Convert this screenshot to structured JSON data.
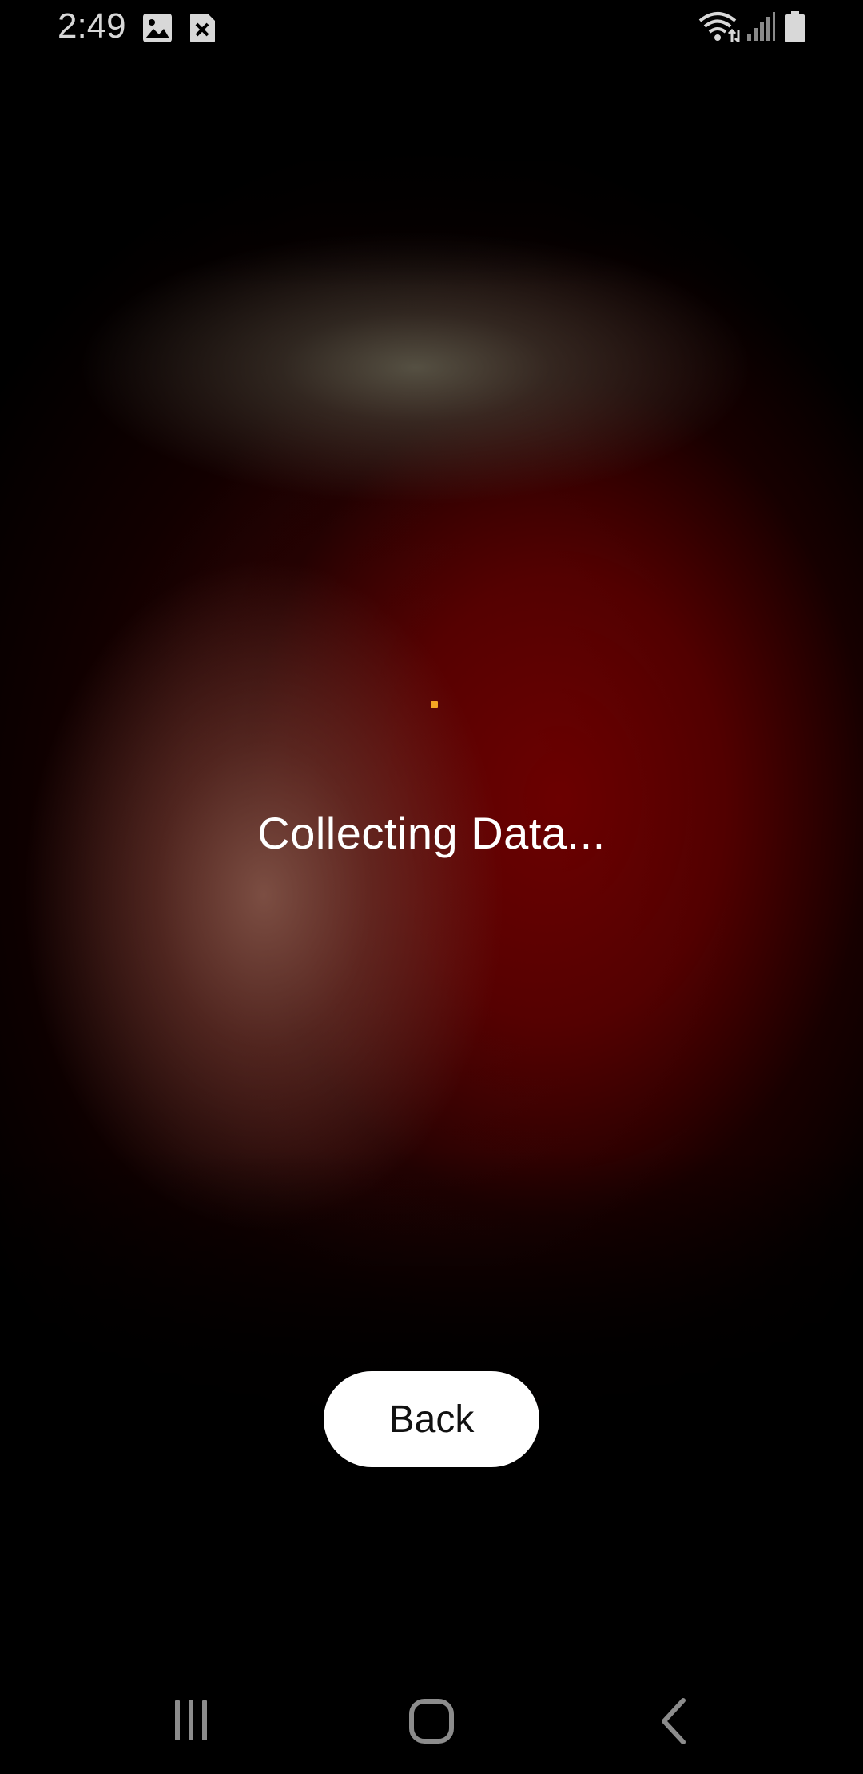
{
  "status_bar": {
    "time": "2:49",
    "icons": [
      "image-icon",
      "notification-x-icon",
      "wifi-icon",
      "signal-icon",
      "battery-icon"
    ]
  },
  "main": {
    "status_text": "Collecting Data...",
    "loading_indicator_color": "#f5a623"
  },
  "actions": {
    "back_label": "Back"
  },
  "nav_bar": {
    "buttons": [
      "recents-icon",
      "home-icon",
      "back-icon"
    ]
  }
}
